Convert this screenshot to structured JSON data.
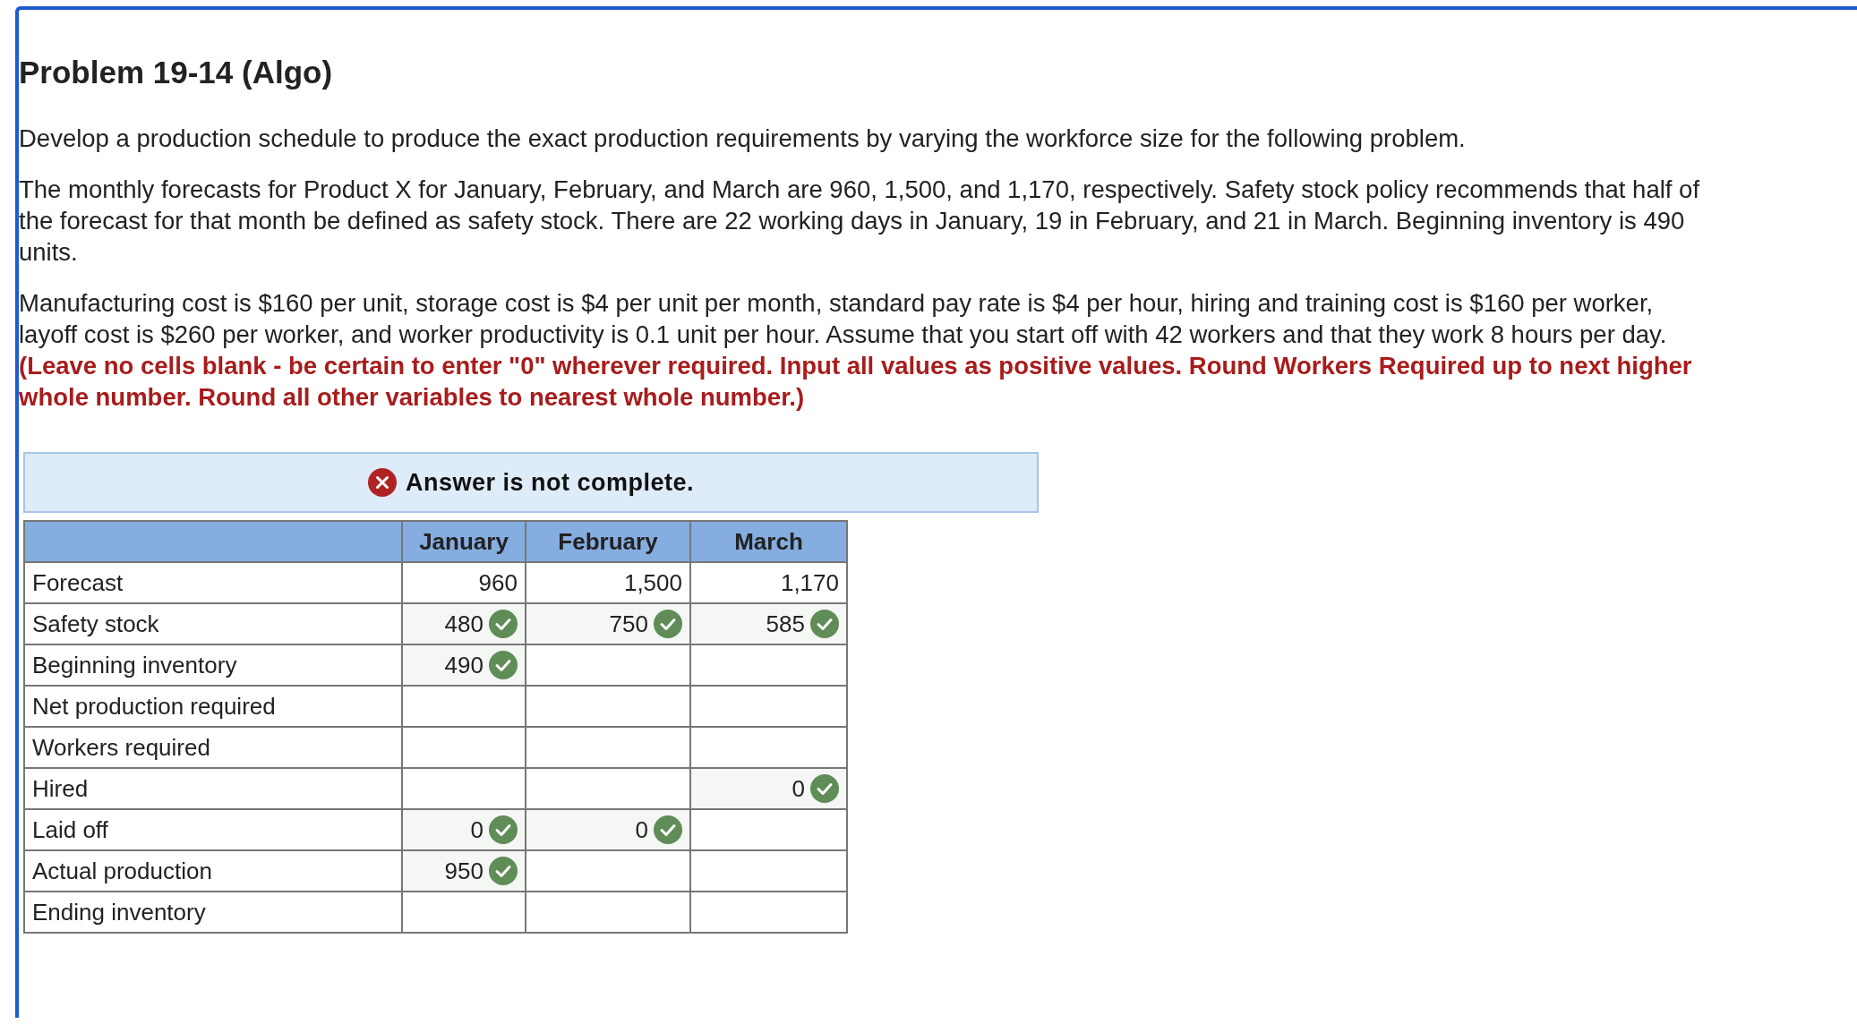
{
  "title": "Problem 19-14 (Algo)",
  "paragraphs": [
    "Develop a production schedule to produce the exact production requirements by varying the workforce size for the following problem.",
    "The monthly forecasts for Product X for January, February, and March are 960, 1,500, and 1,170, respectively. Safety stock policy recommends that half of the forecast for that month be defined as safety stock. There are 22 working days in January, 19 in February, and 21 in March. Beginning inventory is 490 units.",
    "Manufacturing cost is $160 per unit, storage cost is $4 per unit per month, standard pay rate is $4 per hour, hiring and training cost is $160 per worker, layoff cost is $260 per worker, and worker productivity is 0.1 unit per hour. Assume that you start off with 42 workers and that they work 8 hours per day. **(Leave no cells blank - be certain to enter \"0\" wherever required. Input all values as positive values. Round Workers Required up to next higher whole number. Round all other variables to nearest whole number.)**"
  ],
  "answer_status": {
    "text": "Answer is not complete.",
    "complete": false
  },
  "table": {
    "columns": [
      "January",
      "February",
      "March"
    ],
    "rows": [
      {
        "label": "Forecast",
        "cells": [
          {
            "value": "960",
            "correct": false
          },
          {
            "value": "1,500",
            "correct": false
          },
          {
            "value": "1,170",
            "correct": false
          }
        ]
      },
      {
        "label": "Safety stock",
        "cells": [
          {
            "value": "480",
            "correct": true
          },
          {
            "value": "750",
            "correct": true
          },
          {
            "value": "585",
            "correct": true
          }
        ]
      },
      {
        "label": "Beginning inventory",
        "cells": [
          {
            "value": "490",
            "correct": true
          },
          {
            "correct": false
          },
          {
            "correct": false
          }
        ]
      },
      {
        "label": "Net production required",
        "cells": [
          {
            "correct": false
          },
          {
            "correct": false
          },
          {
            "correct": false
          }
        ]
      },
      {
        "label": "Workers required",
        "cells": [
          {
            "correct": false
          },
          {
            "correct": false
          },
          {
            "correct": false
          }
        ]
      },
      {
        "label": "Hired",
        "cells": [
          {
            "correct": false
          },
          {
            "correct": false
          },
          {
            "value": "0",
            "correct": true
          }
        ]
      },
      {
        "label": "Laid off",
        "cells": [
          {
            "value": "0",
            "correct": true
          },
          {
            "value": "0",
            "correct": true
          },
          {
            "correct": false
          }
        ]
      },
      {
        "label": "Actual production",
        "cells": [
          {
            "value": "950",
            "correct": true
          },
          {
            "correct": false
          },
          {
            "correct": false
          }
        ]
      },
      {
        "label": "Ending inventory",
        "cells": [
          {
            "correct": false
          },
          {
            "correct": false
          },
          {
            "correct": false
          }
        ]
      }
    ]
  }
}
